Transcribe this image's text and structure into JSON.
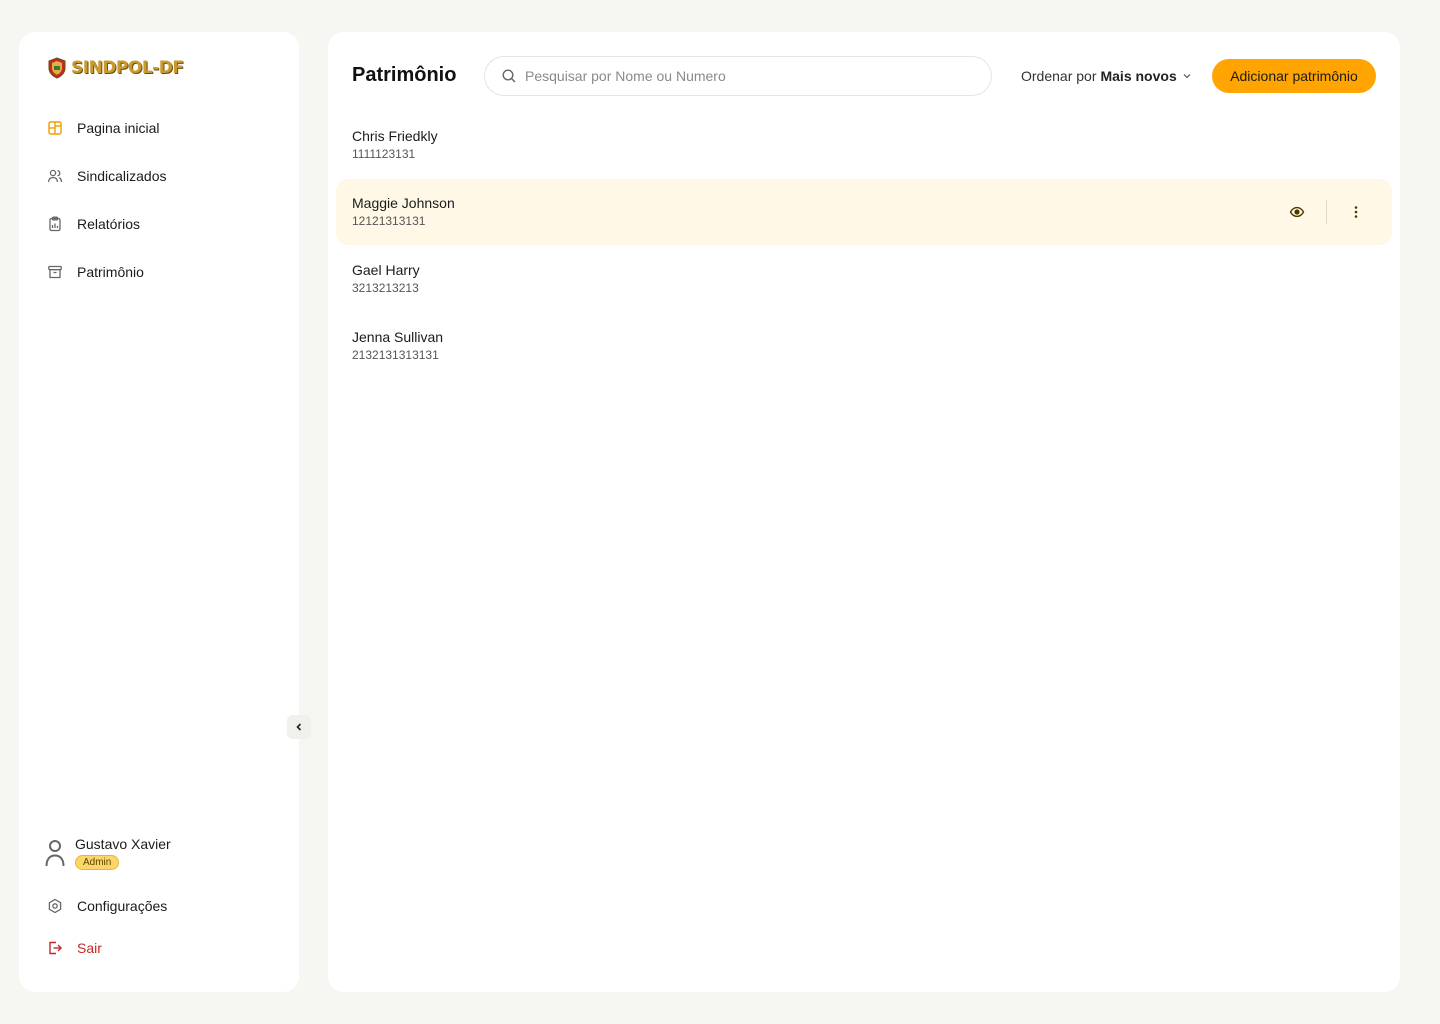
{
  "app": {
    "logo_text": "SINDPOL-DF"
  },
  "sidebar": {
    "items": [
      {
        "label": "Pagina inicial",
        "icon": "dashboard-icon"
      },
      {
        "label": "Sindicalizados",
        "icon": "users-icon"
      },
      {
        "label": "Relatórios",
        "icon": "clipboard-icon"
      },
      {
        "label": "Patrimônio",
        "icon": "archive-icon"
      }
    ],
    "user": {
      "name": "Gustavo Xavier",
      "role": "Admin"
    },
    "settings_label": "Configurações",
    "logout_label": "Sair"
  },
  "main": {
    "title": "Patrimônio",
    "search": {
      "placeholder": "Pesquisar por Nome ou Numero",
      "value": ""
    },
    "sort": {
      "label": "Ordenar por",
      "value": "Mais novos"
    },
    "add_button": "Adicionar patrimônio",
    "rows": [
      {
        "name": "Chris Friedkly",
        "number": "1111123131"
      },
      {
        "name": "Maggie Johnson",
        "number": "12121313131"
      },
      {
        "name": "Gael Harry",
        "number": "3213213213"
      },
      {
        "name": "Jenna Sullivan",
        "number": "2132131313131"
      }
    ]
  },
  "colors": {
    "accent": "#ffa400",
    "active_row": "#fff8e6",
    "logout": "#c62828",
    "brand_gold": "#c99a2e"
  }
}
